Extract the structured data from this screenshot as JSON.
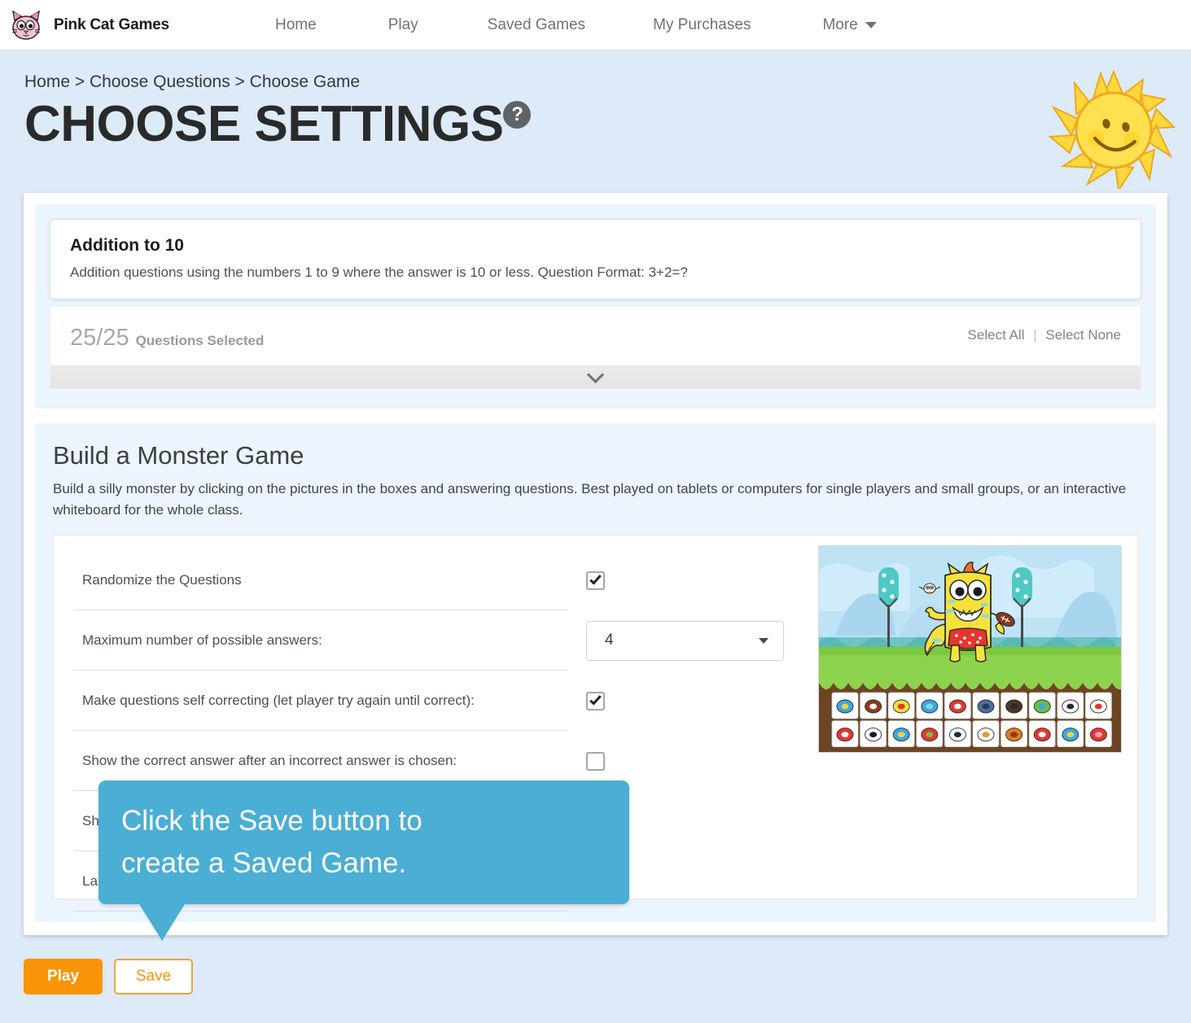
{
  "nav": {
    "brand_label": "Pink Cat Games",
    "brand_icon": "pink-cat-logo",
    "links": [
      {
        "label": "Home",
        "icon": null
      },
      {
        "label": "Play",
        "icon": null
      },
      {
        "label": "Saved Games",
        "icon": null
      },
      {
        "label": "My Purchases",
        "icon": null
      },
      {
        "label": "More",
        "icon": "chevron-down-icon"
      }
    ]
  },
  "header": {
    "breadcrumb": "Home > Choose Questions > Choose Game",
    "title": "CHOOSE SETTINGS",
    "help_icon": "?",
    "decor_icon": "smiling-sun-icon"
  },
  "question_set": {
    "title": "Addition to 10",
    "description": "Addition questions using the numbers 1 to 9 where the answer is 10 or less. Question Format: 3+2=?",
    "selected_count": "25/25",
    "selected_label": "Questions Selected",
    "select_all": "Select All",
    "separator": "|",
    "select_none": "Select None",
    "expand_icon": "chevron-down-icon"
  },
  "game": {
    "title": "Build a Monster Game",
    "description": "Build a silly monster by clicking on the pictures in the boxes and answering questions. Best played on tablets or computers for single players and small groups, or an interactive whiteboard for the whole class.",
    "preview_icon": "build-a-monster-preview",
    "settings": [
      {
        "label": "Randomize the Questions",
        "control": "checkbox",
        "checked": true
      },
      {
        "label": "Maximum number of possible answers:",
        "control": "select",
        "value": "4"
      },
      {
        "label": "Make questions self correcting (let player try again until correct):",
        "control": "checkbox",
        "checked": true
      },
      {
        "label": "Show the correct answer after an incorrect answer is chosen:",
        "control": "checkbox",
        "checked": false
      },
      {
        "label": "Sho",
        "control": "hidden-behind-tooltip",
        "checked": false
      },
      {
        "label": "Lab",
        "control": "hidden-behind-tooltip",
        "checked": false
      }
    ]
  },
  "tooltip": {
    "line1": "Click the Save button to",
    "line2": "create a Saved Game.",
    "color": "#4baed4"
  },
  "footer": {
    "play_label": "Play",
    "save_label": "Save",
    "play_color": "#f89406",
    "save_color": "#f89406"
  }
}
